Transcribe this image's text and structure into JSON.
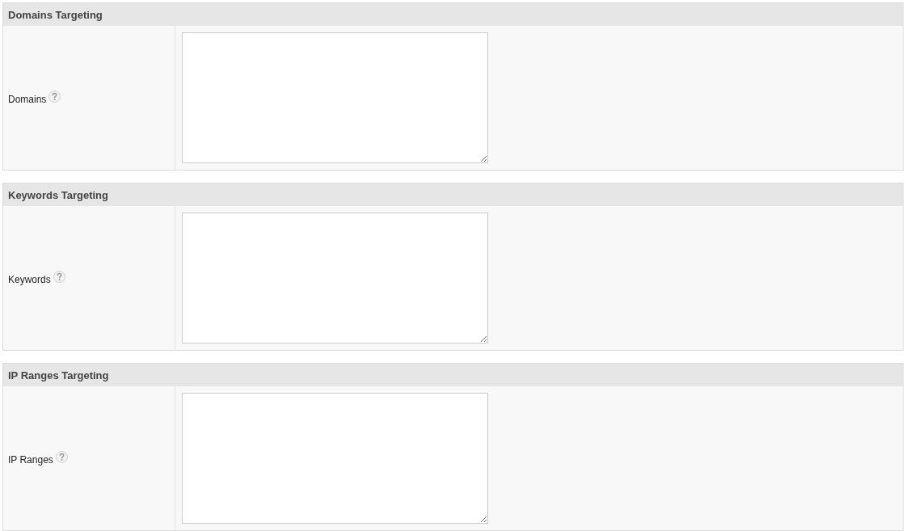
{
  "sections": [
    {
      "title": "Domains Targeting",
      "field": {
        "label": "Domains"
      }
    },
    {
      "title": "Keywords Targeting",
      "field": {
        "label": "Keywords"
      }
    },
    {
      "title": "IP Ranges Targeting",
      "field": {
        "label": "IP Ranges"
      }
    }
  ]
}
